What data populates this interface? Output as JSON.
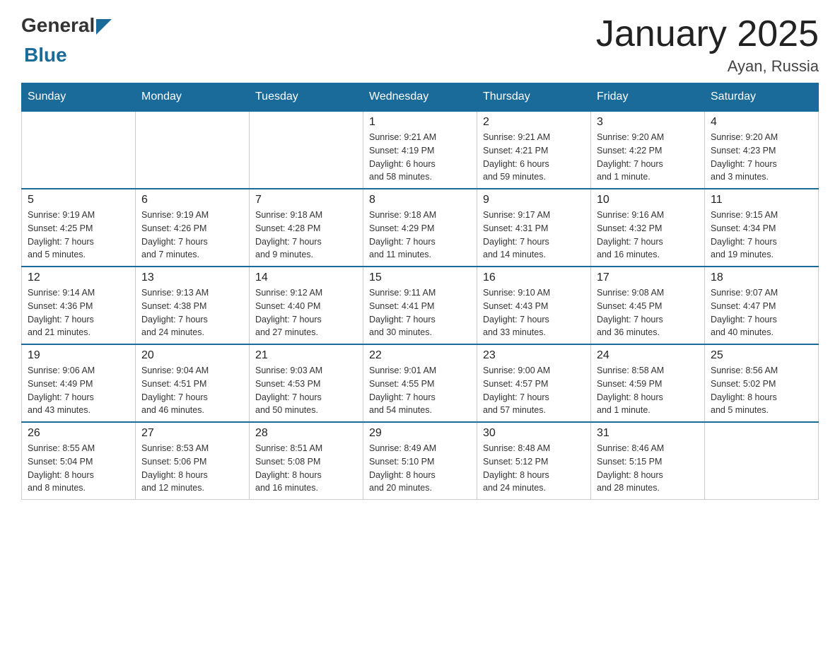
{
  "header": {
    "logo": {
      "general": "General",
      "blue": "Blue",
      "arrow": "▶"
    },
    "title": "January 2025",
    "subtitle": "Ayan, Russia"
  },
  "weekdays": [
    "Sunday",
    "Monday",
    "Tuesday",
    "Wednesday",
    "Thursday",
    "Friday",
    "Saturday"
  ],
  "weeks": [
    [
      {
        "day": "",
        "info": ""
      },
      {
        "day": "",
        "info": ""
      },
      {
        "day": "",
        "info": ""
      },
      {
        "day": "1",
        "info": "Sunrise: 9:21 AM\nSunset: 4:19 PM\nDaylight: 6 hours\nand 58 minutes."
      },
      {
        "day": "2",
        "info": "Sunrise: 9:21 AM\nSunset: 4:21 PM\nDaylight: 6 hours\nand 59 minutes."
      },
      {
        "day": "3",
        "info": "Sunrise: 9:20 AM\nSunset: 4:22 PM\nDaylight: 7 hours\nand 1 minute."
      },
      {
        "day": "4",
        "info": "Sunrise: 9:20 AM\nSunset: 4:23 PM\nDaylight: 7 hours\nand 3 minutes."
      }
    ],
    [
      {
        "day": "5",
        "info": "Sunrise: 9:19 AM\nSunset: 4:25 PM\nDaylight: 7 hours\nand 5 minutes."
      },
      {
        "day": "6",
        "info": "Sunrise: 9:19 AM\nSunset: 4:26 PM\nDaylight: 7 hours\nand 7 minutes."
      },
      {
        "day": "7",
        "info": "Sunrise: 9:18 AM\nSunset: 4:28 PM\nDaylight: 7 hours\nand 9 minutes."
      },
      {
        "day": "8",
        "info": "Sunrise: 9:18 AM\nSunset: 4:29 PM\nDaylight: 7 hours\nand 11 minutes."
      },
      {
        "day": "9",
        "info": "Sunrise: 9:17 AM\nSunset: 4:31 PM\nDaylight: 7 hours\nand 14 minutes."
      },
      {
        "day": "10",
        "info": "Sunrise: 9:16 AM\nSunset: 4:32 PM\nDaylight: 7 hours\nand 16 minutes."
      },
      {
        "day": "11",
        "info": "Sunrise: 9:15 AM\nSunset: 4:34 PM\nDaylight: 7 hours\nand 19 minutes."
      }
    ],
    [
      {
        "day": "12",
        "info": "Sunrise: 9:14 AM\nSunset: 4:36 PM\nDaylight: 7 hours\nand 21 minutes."
      },
      {
        "day": "13",
        "info": "Sunrise: 9:13 AM\nSunset: 4:38 PM\nDaylight: 7 hours\nand 24 minutes."
      },
      {
        "day": "14",
        "info": "Sunrise: 9:12 AM\nSunset: 4:40 PM\nDaylight: 7 hours\nand 27 minutes."
      },
      {
        "day": "15",
        "info": "Sunrise: 9:11 AM\nSunset: 4:41 PM\nDaylight: 7 hours\nand 30 minutes."
      },
      {
        "day": "16",
        "info": "Sunrise: 9:10 AM\nSunset: 4:43 PM\nDaylight: 7 hours\nand 33 minutes."
      },
      {
        "day": "17",
        "info": "Sunrise: 9:08 AM\nSunset: 4:45 PM\nDaylight: 7 hours\nand 36 minutes."
      },
      {
        "day": "18",
        "info": "Sunrise: 9:07 AM\nSunset: 4:47 PM\nDaylight: 7 hours\nand 40 minutes."
      }
    ],
    [
      {
        "day": "19",
        "info": "Sunrise: 9:06 AM\nSunset: 4:49 PM\nDaylight: 7 hours\nand 43 minutes."
      },
      {
        "day": "20",
        "info": "Sunrise: 9:04 AM\nSunset: 4:51 PM\nDaylight: 7 hours\nand 46 minutes."
      },
      {
        "day": "21",
        "info": "Sunrise: 9:03 AM\nSunset: 4:53 PM\nDaylight: 7 hours\nand 50 minutes."
      },
      {
        "day": "22",
        "info": "Sunrise: 9:01 AM\nSunset: 4:55 PM\nDaylight: 7 hours\nand 54 minutes."
      },
      {
        "day": "23",
        "info": "Sunrise: 9:00 AM\nSunset: 4:57 PM\nDaylight: 7 hours\nand 57 minutes."
      },
      {
        "day": "24",
        "info": "Sunrise: 8:58 AM\nSunset: 4:59 PM\nDaylight: 8 hours\nand 1 minute."
      },
      {
        "day": "25",
        "info": "Sunrise: 8:56 AM\nSunset: 5:02 PM\nDaylight: 8 hours\nand 5 minutes."
      }
    ],
    [
      {
        "day": "26",
        "info": "Sunrise: 8:55 AM\nSunset: 5:04 PM\nDaylight: 8 hours\nand 8 minutes."
      },
      {
        "day": "27",
        "info": "Sunrise: 8:53 AM\nSunset: 5:06 PM\nDaylight: 8 hours\nand 12 minutes."
      },
      {
        "day": "28",
        "info": "Sunrise: 8:51 AM\nSunset: 5:08 PM\nDaylight: 8 hours\nand 16 minutes."
      },
      {
        "day": "29",
        "info": "Sunrise: 8:49 AM\nSunset: 5:10 PM\nDaylight: 8 hours\nand 20 minutes."
      },
      {
        "day": "30",
        "info": "Sunrise: 8:48 AM\nSunset: 5:12 PM\nDaylight: 8 hours\nand 24 minutes."
      },
      {
        "day": "31",
        "info": "Sunrise: 8:46 AM\nSunset: 5:15 PM\nDaylight: 8 hours\nand 28 minutes."
      },
      {
        "day": "",
        "info": ""
      }
    ]
  ]
}
